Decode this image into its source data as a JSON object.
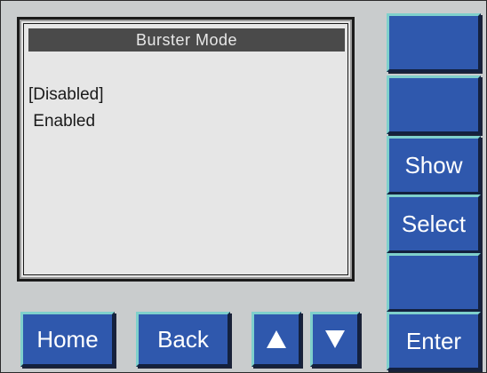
{
  "screen": {
    "title": "Burster Mode",
    "options": [
      "[Disabled]",
      " Enabled"
    ]
  },
  "side_buttons": [
    {
      "label": ""
    },
    {
      "label": ""
    },
    {
      "label": "Show"
    },
    {
      "label": "Select"
    },
    {
      "label": ""
    },
    {
      "label": "Enter"
    }
  ],
  "bottom_buttons": {
    "home": "Home",
    "back": "Back",
    "up_icon": "up-arrow-icon",
    "down_icon": "down-arrow-icon"
  },
  "colors": {
    "button_face": "#2f58ad",
    "button_highlight": "#7fd0cc",
    "panel": "#c9cccd",
    "screen": "#e6e6e6",
    "title_bar": "#4a4a4a"
  }
}
